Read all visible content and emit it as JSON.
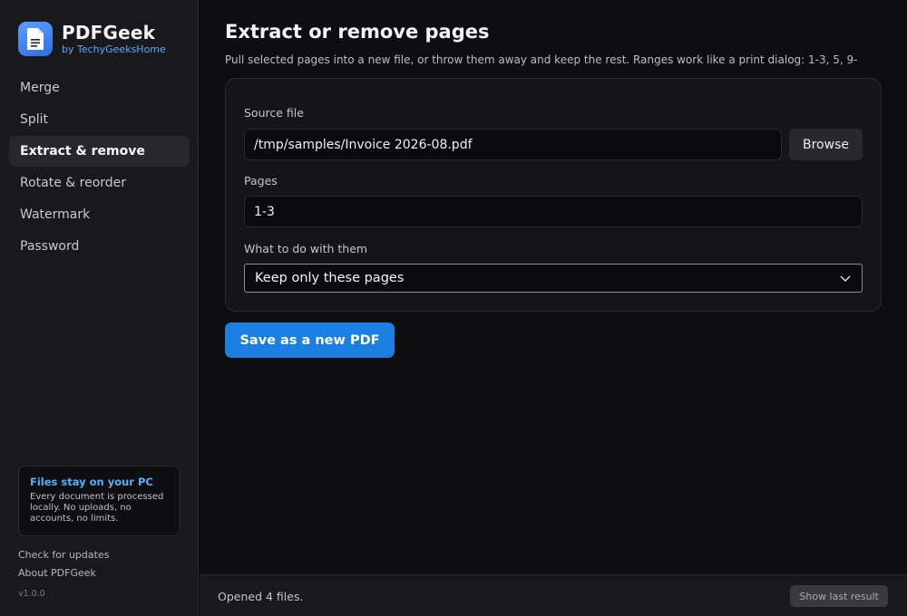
{
  "app": {
    "name": "PDFGeek",
    "byline": "by TechyGeeksHome",
    "logo_icon": "document-icon",
    "accent_color": "#1a7fe0"
  },
  "sidebar": {
    "items": [
      {
        "label": "Merge",
        "active": false
      },
      {
        "label": "Split",
        "active": false
      },
      {
        "label": "Extract & remove",
        "active": true
      },
      {
        "label": "Rotate & reorder",
        "active": false
      },
      {
        "label": "Watermark",
        "active": false
      },
      {
        "label": "Password",
        "active": false
      }
    ],
    "privacy": {
      "title": "Files stay on your PC",
      "body": "Every document is processed locally. No uploads, no accounts, no limits."
    },
    "check_updates": "Check for updates",
    "about": "About PDFGeek",
    "version": "v1.0.0"
  },
  "main": {
    "title": "Extract or remove pages",
    "subtitle": "Pull selected pages into a new file, or throw them away and keep the rest. Ranges work like a print dialog: 1-3, 5, 9-",
    "source": {
      "label": "Source file",
      "value": "/tmp/samples/Invoice 2026-08.pdf",
      "browse_label": "Browse"
    },
    "pages": {
      "label": "Pages",
      "value": "1-3"
    },
    "action": {
      "label": "What to do with them",
      "selected": "Keep only these pages"
    },
    "submit_label": "Save as a new PDF"
  },
  "status": {
    "text": "Opened 4 files.",
    "last_result_label": "Show last result"
  }
}
